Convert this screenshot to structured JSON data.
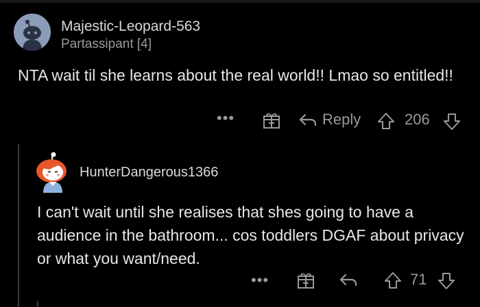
{
  "comments": [
    {
      "author": "Majestic-Leopard-563",
      "flair": "Partassipant [4]",
      "body": "NTA wait til she learns about the real world!! Lmao so entitled!!",
      "reply_label": "Reply",
      "score": "206"
    },
    {
      "author": "HunterDangerous1366",
      "body": "I can't wait until she realises that shes going to have a audience in the bathroom... cos toddlers DGAF about privacy or what you want/need.",
      "score": "71"
    }
  ],
  "icons": {
    "more": "more-options-icon",
    "award": "gift-award-icon",
    "reply": "reply-arrow-icon",
    "upvote": "upvote-arrow-icon",
    "downvote": "downvote-arrow-icon"
  },
  "colors": {
    "background": "#000000",
    "text": "#e8e8e8",
    "muted": "#9a9a9a",
    "thread_line": "#3a3a3c",
    "avatar1_bg": "#8c9bb8",
    "avatar2_hair": "#e8572a"
  }
}
